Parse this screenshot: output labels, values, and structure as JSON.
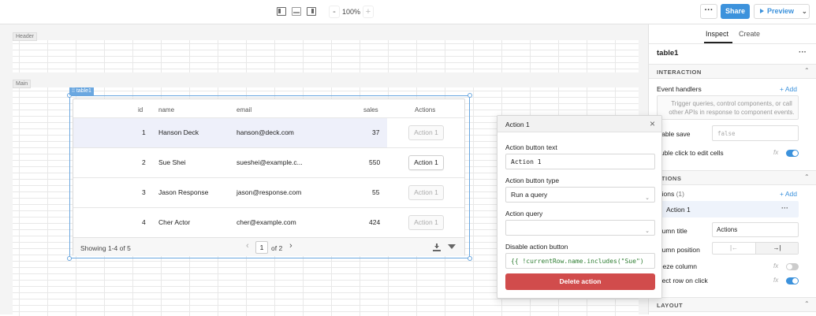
{
  "toolbar": {
    "zoom_minus": "-",
    "zoom": "100%",
    "zoom_plus": "+",
    "more": "···",
    "share": "Share",
    "preview": "Preview"
  },
  "canvas": {
    "header_label": "Header",
    "main_label": "Main",
    "component_tag": "table1"
  },
  "table": {
    "columns": [
      "id",
      "name",
      "email",
      "sales",
      "Actions"
    ],
    "rows": [
      {
        "id": "1",
        "name": "Hanson Deck",
        "email": "hanson@deck.com",
        "sales": "37",
        "action": "Action 1"
      },
      {
        "id": "2",
        "name": "Sue Shei",
        "email": "sueshei@example.c...",
        "sales": "550",
        "action": "Action 1"
      },
      {
        "id": "3",
        "name": "Jason Response",
        "email": "jason@response.com",
        "sales": "55",
        "action": "Action 1"
      },
      {
        "id": "4",
        "name": "Cher Actor",
        "email": "cher@example.com",
        "sales": "424",
        "action": "Action 1"
      }
    ],
    "footer": {
      "showing": "Showing 1-4 of 5",
      "page": "1",
      "of_pages": "of 2",
      "prev": "‹",
      "next": "›"
    }
  },
  "popover": {
    "title": "Action 1",
    "close": "×",
    "button_text_label": "Action button text",
    "button_text_value": "Action 1",
    "button_type_label": "Action button type",
    "button_type_value": "Run a query",
    "query_label": "Action query",
    "query_value": "",
    "disable_label": "Disable action button",
    "disable_value": "{{ !currentRow.name.includes(\"Sue\") }}",
    "delete": "Delete action"
  },
  "inspector": {
    "tabs": [
      "Inspect",
      "Create"
    ],
    "component_name": "table1",
    "more": "···",
    "interaction_title": "INTERACTION",
    "event_handlers": "Event handlers",
    "add": "+ Add",
    "event_placeholder": "Trigger queries, control components, or call other APIs in response to component events.",
    "disable_save": "isable save",
    "disable_save_value": "false",
    "double_click": "ouble click to edit cells",
    "fx": "fx",
    "actions_title": "CTIONS",
    "actions_label": "ctions",
    "actions_count": "(1)",
    "action_item": "Action 1",
    "column_title_label": "olumn title",
    "column_title_value": "Actions",
    "column_position_label": "olumn position",
    "freeze_column": "reeze column",
    "select_row": "elect row on click",
    "layout_title": "LAYOUT"
  }
}
